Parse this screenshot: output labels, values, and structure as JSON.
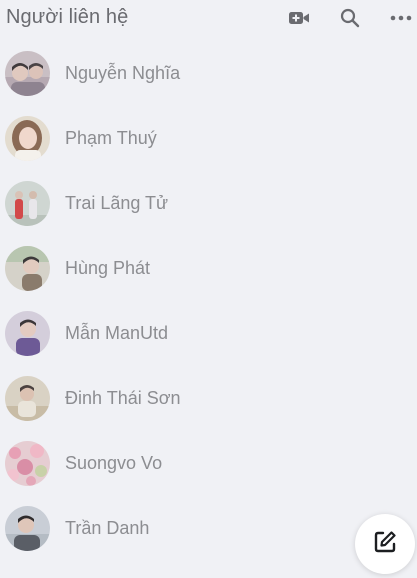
{
  "header": {
    "title": "Người liên hệ",
    "video_call_icon": "video-camera-plus-icon",
    "search_icon": "search-icon",
    "more_icon": "more-horizontal-icon"
  },
  "contacts": [
    {
      "name": "Nguyễn Nghĩa"
    },
    {
      "name": "Phạm Thuý"
    },
    {
      "name": "Trai Lãng Tử"
    },
    {
      "name": "Hùng Phát"
    },
    {
      "name": "Mẫn ManUtd"
    },
    {
      "name": "Đinh Thái Sơn"
    },
    {
      "name": "Suongvo Vo"
    },
    {
      "name": "Trần Danh"
    }
  ],
  "compose": {
    "icon": "compose-edit-icon"
  }
}
